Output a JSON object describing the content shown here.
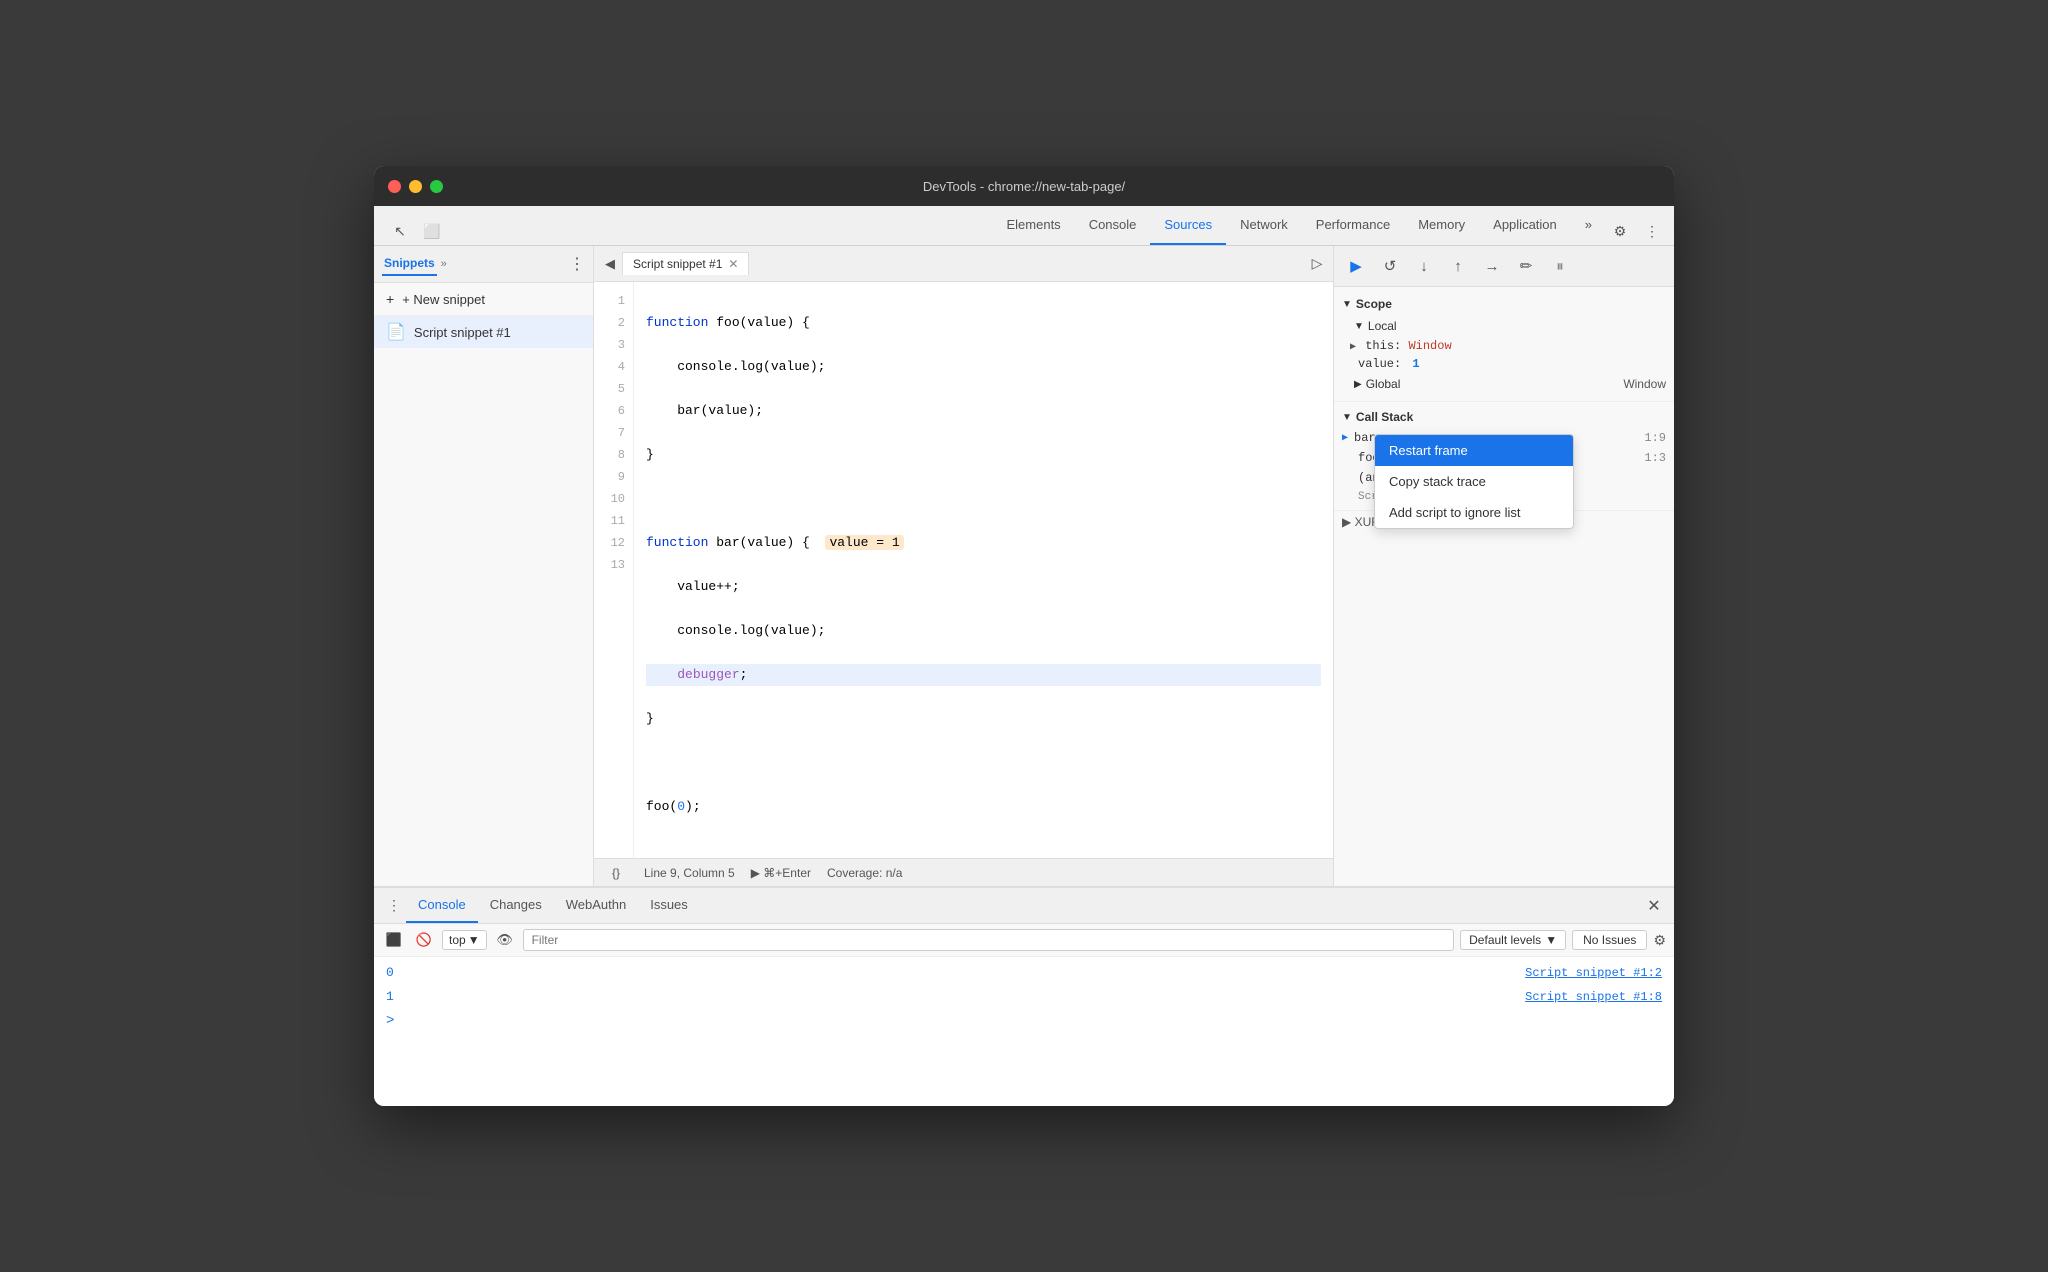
{
  "window": {
    "title": "DevTools - chrome://new-tab-page/"
  },
  "tabs": {
    "items": [
      {
        "label": "Elements",
        "active": false
      },
      {
        "label": "Console",
        "active": false
      },
      {
        "label": "Sources",
        "active": true
      },
      {
        "label": "Network",
        "active": false
      },
      {
        "label": "Performance",
        "active": false
      },
      {
        "label": "Memory",
        "active": false
      },
      {
        "label": "Application",
        "active": false
      }
    ]
  },
  "sidebar": {
    "tab_label": "Snippets",
    "new_snippet_label": "+ New snippet",
    "snippet_item_label": "Script snippet #1"
  },
  "editor": {
    "tab_label": "Script snippet #1",
    "status": {
      "line_col": "Line 9, Column 5",
      "run_label": "⌘+Enter",
      "coverage": "Coverage: n/a"
    },
    "code_lines": [
      {
        "num": 1,
        "text": "function foo(value) {"
      },
      {
        "num": 2,
        "text": "    console.log(value);"
      },
      {
        "num": 3,
        "text": "    bar(value);"
      },
      {
        "num": 4,
        "text": "}"
      },
      {
        "num": 5,
        "text": ""
      },
      {
        "num": 6,
        "text": "function bar(value) {"
      },
      {
        "num": 7,
        "text": "    value++;"
      },
      {
        "num": 8,
        "text": "    console.log(value);"
      },
      {
        "num": 9,
        "text": "    debugger;"
      },
      {
        "num": 10,
        "text": "}"
      },
      {
        "num": 11,
        "text": ""
      },
      {
        "num": 12,
        "text": "foo(0);"
      },
      {
        "num": 13,
        "text": ""
      }
    ]
  },
  "right_panel": {
    "scope": {
      "header": "Scope",
      "local_header": "Local",
      "this_label": "this:",
      "this_val": "Window",
      "value_label": "value:",
      "value_val": "1",
      "global_header": "Global",
      "global_val": "Window"
    },
    "callstack": {
      "header": "Call Stack",
      "items": [
        {
          "name": "bar",
          "line": "1:9"
        },
        {
          "name": "foo",
          "line": "1:3"
        },
        {
          "name": "(anon",
          "line": ""
        }
      ],
      "script_source": "Script snippet #1:12"
    },
    "context_menu": {
      "items": [
        {
          "label": "Restart frame",
          "selected": true
        },
        {
          "label": "Copy stack trace",
          "selected": false
        },
        {
          "label": "Add script to ignore list",
          "selected": false
        }
      ]
    }
  },
  "bottom_panel": {
    "tabs": [
      {
        "label": "Console",
        "active": true
      },
      {
        "label": "Changes",
        "active": false
      },
      {
        "label": "WebAuthn",
        "active": false
      },
      {
        "label": "Issues",
        "active": false
      }
    ],
    "console": {
      "top_label": "top",
      "filter_placeholder": "Filter",
      "default_levels_label": "Default levels",
      "no_issues_label": "No Issues",
      "rows": [
        {
          "val": "0",
          "source": "Script snippet #1:2"
        },
        {
          "val": "1",
          "source": "Script snippet #1:8"
        }
      ],
      "prompt": ">"
    }
  },
  "xhr_section": {
    "label": "▶ XUR/fetch Breakpoints"
  }
}
